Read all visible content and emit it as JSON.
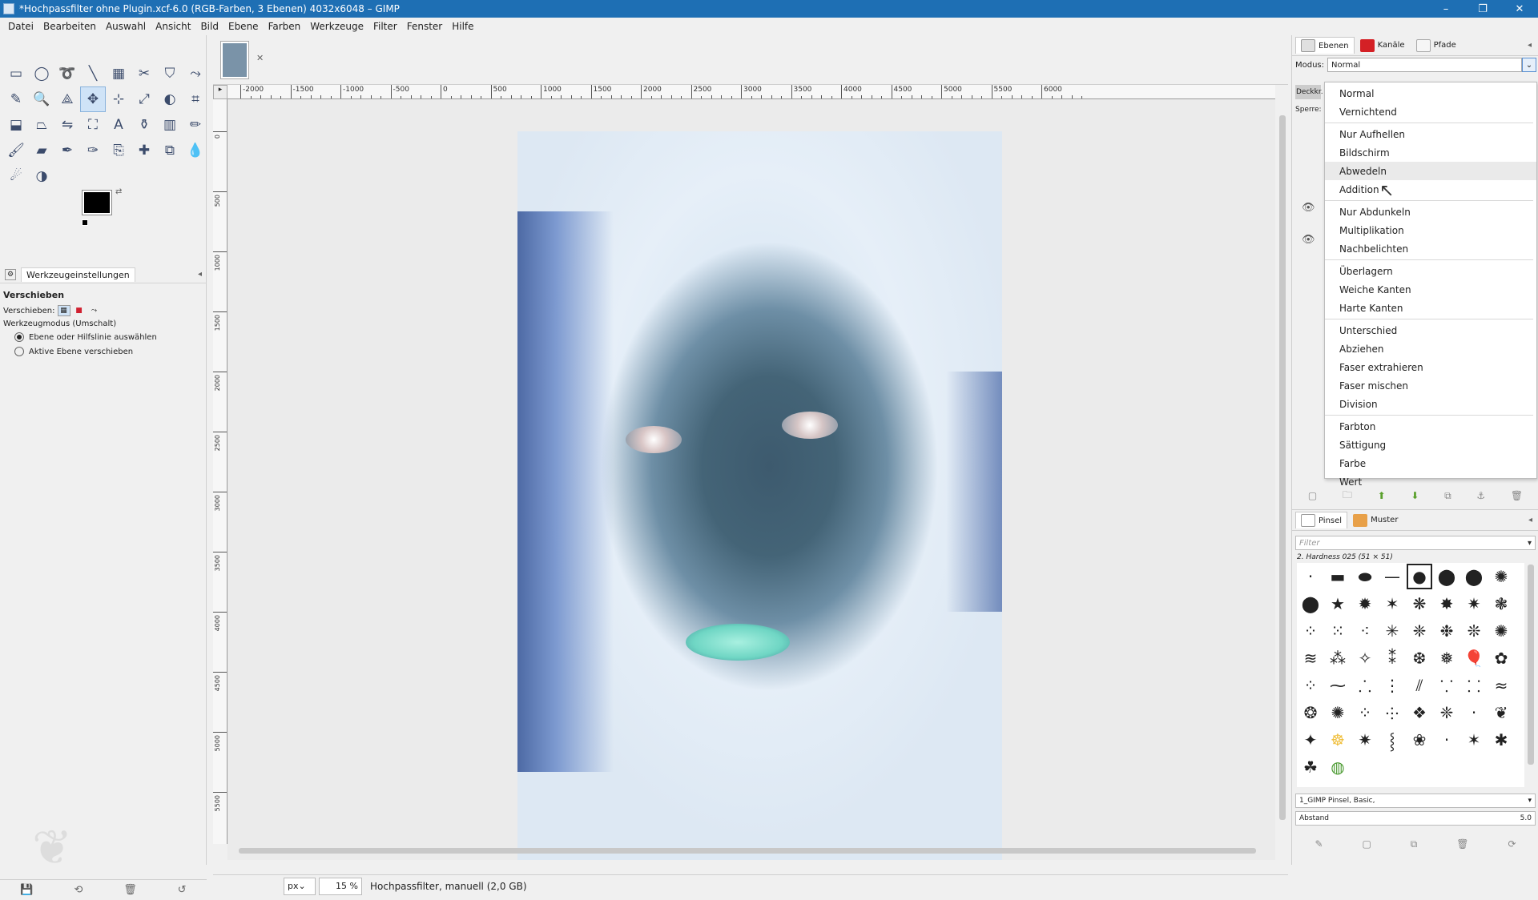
{
  "window": {
    "title": "*Hochpassfilter ohne Plugin.xcf-6.0 (RGB-Farben, 3 Ebenen) 4032x6048 – GIMP",
    "minimize": "–",
    "maximize": "❐",
    "close": "✕"
  },
  "menu": [
    "Datei",
    "Bearbeiten",
    "Auswahl",
    "Ansicht",
    "Bild",
    "Ebene",
    "Farben",
    "Werkzeuge",
    "Filter",
    "Fenster",
    "Hilfe"
  ],
  "toolbox": {
    "tools": [
      {
        "name": "rect-select-icon",
        "glyph": "▭"
      },
      {
        "name": "ellipse-select-icon",
        "glyph": "◯"
      },
      {
        "name": "free-select-icon",
        "glyph": "➰"
      },
      {
        "name": "fuzzy-select-icon",
        "glyph": "╲"
      },
      {
        "name": "select-by-color-icon",
        "glyph": "▦"
      },
      {
        "name": "scissors-icon",
        "glyph": "✂"
      },
      {
        "name": "foreground-select-icon",
        "glyph": "⛉"
      },
      {
        "name": "paths-icon",
        "glyph": "⤳"
      },
      {
        "name": "color-picker-icon",
        "glyph": "✎"
      },
      {
        "name": "zoom-icon",
        "glyph": "🔍"
      },
      {
        "name": "measure-icon",
        "glyph": "⟁"
      },
      {
        "name": "move-icon",
        "glyph": "✥"
      },
      {
        "name": "align-icon",
        "glyph": "⊹"
      },
      {
        "name": "transform-icon",
        "glyph": "⤢"
      },
      {
        "name": "warp-icon",
        "glyph": "◐"
      },
      {
        "name": "crop-icon",
        "glyph": "⌗"
      },
      {
        "name": "perspective-icon",
        "glyph": "⬓"
      },
      {
        "name": "shear-icon",
        "glyph": "⏢"
      },
      {
        "name": "flip-icon",
        "glyph": "⇋"
      },
      {
        "name": "cage-icon",
        "glyph": "⛶"
      },
      {
        "name": "text-icon",
        "glyph": "A"
      },
      {
        "name": "bucket-fill-icon",
        "glyph": "⚱"
      },
      {
        "name": "gradient-icon",
        "glyph": "▥"
      },
      {
        "name": "pencil-icon",
        "glyph": "✏"
      },
      {
        "name": "paintbrush-icon",
        "glyph": "🖌"
      },
      {
        "name": "eraser-icon",
        "glyph": "▰"
      },
      {
        "name": "airbrush-icon",
        "glyph": "✒"
      },
      {
        "name": "ink-icon",
        "glyph": "✑"
      },
      {
        "name": "clone-icon",
        "glyph": "⎘"
      },
      {
        "name": "heal-icon",
        "glyph": "✚"
      },
      {
        "name": "perspective-clone-icon",
        "glyph": "⧉"
      },
      {
        "name": "blur-icon",
        "glyph": "💧"
      },
      {
        "name": "smudge-icon",
        "glyph": "☄"
      },
      {
        "name": "dodge-burn-icon",
        "glyph": "◑"
      }
    ],
    "active_tool_index": 11
  },
  "tool_options": {
    "tab_label": "Werkzeugeinstellungen",
    "title": "Verschieben",
    "move_label": "Verschieben:",
    "mode_label": "Werkzeugmodus (Umschalt)",
    "option1": "Ebene oder Hilfslinie auswählen",
    "option2": "Aktive Ebene verschieben",
    "selected_option": 1
  },
  "canvas": {
    "ruler_labels": [
      "-2000",
      "-1500",
      "-1000",
      "-500",
      "0",
      "500",
      "1000",
      "1500",
      "2000",
      "2500",
      "3000",
      "3500",
      "4000",
      "4500",
      "5000",
      "5500",
      "6000"
    ],
    "vruler_labels": [
      "0",
      "500",
      "1000",
      "1500",
      "2000",
      "2500",
      "3000",
      "3500",
      "4000",
      "4500",
      "5000",
      "5500"
    ]
  },
  "status": {
    "unit": "px",
    "zoom": "15 %",
    "message": "Hochpassfilter, manuell (2,0 GB)"
  },
  "layers_dock": {
    "tab_layers": "Ebenen",
    "tab_channels": "Kanäle",
    "tab_paths": "Pfade",
    "modus_label": "Modus:",
    "modus_value": "Normal",
    "opacity_label": "Deckkr.",
    "lock_label": "Sperre:"
  },
  "mode_menu": {
    "groups": [
      [
        "Normal",
        "Vernichtend"
      ],
      [
        "Nur Aufhellen",
        "Bildschirm",
        "Abwedeln",
        "Addition"
      ],
      [
        "Nur Abdunkeln",
        "Multiplikation",
        "Nachbelichten"
      ],
      [
        "Überlagern",
        "Weiche Kanten",
        "Harte Kanten"
      ],
      [
        "Unterschied",
        "Abziehen",
        "Faser extrahieren",
        "Faser mischen",
        "Division"
      ],
      [
        "Farbton",
        "Sättigung",
        "Farbe",
        "Wert"
      ]
    ],
    "highlighted": "Abwedeln"
  },
  "brushes_dock": {
    "tab_brushes": "Pinsel",
    "tab_patterns": "Muster",
    "filter_placeholder": "Filter",
    "brush_name": "2. Hardness 025 (51 × 51)",
    "tag_value": "1_GIMP Pinsel, Basic,",
    "spacing_label": "Abstand",
    "spacing_value": "5.0"
  },
  "colors": {
    "titlebar": "#1e6fb4",
    "panel": "#f0f0f0",
    "highlight": "#cfe3f7"
  }
}
